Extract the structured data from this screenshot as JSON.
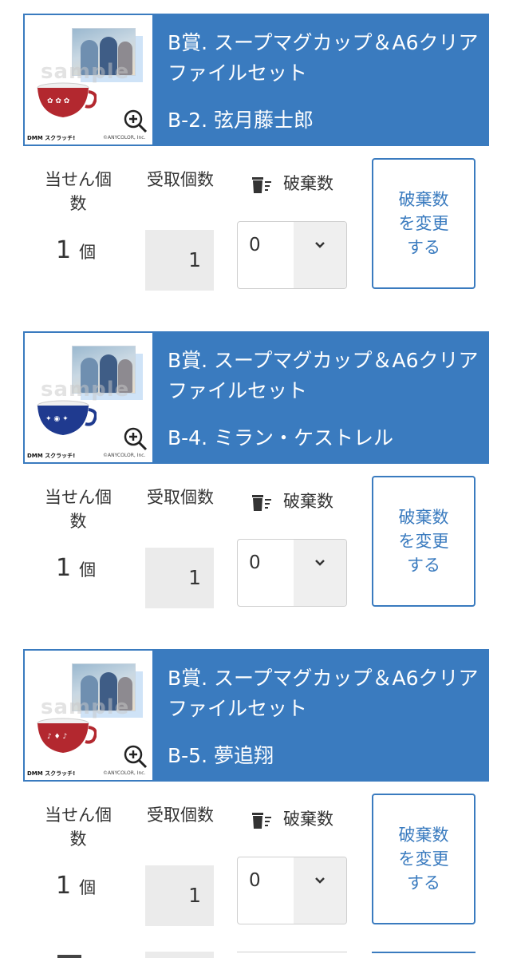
{
  "labels": {
    "won": "当せん個数",
    "received": "受取個数",
    "discard": "破棄数",
    "unit": "個",
    "change_button": "破棄数を変更する"
  },
  "thumbnail": {
    "watermark": "sample",
    "dmm_logo": "DMM スクラッチ!",
    "copyright": "©ANYCOLOR, Inc."
  },
  "items": [
    {
      "title": "B賞. スープマグカップ＆A6クリアファイルセット",
      "variant": "B-2. 弦月藤士郎",
      "won_count": "1",
      "received_count": "1",
      "discard_value": "0",
      "cup_color": "#b3282f",
      "cup_icon": "mug-red"
    },
    {
      "title": "B賞. スープマグカップ＆A6クリアファイルセット",
      "variant": "B-4. ミラン・ケストレル",
      "won_count": "1",
      "received_count": "1",
      "discard_value": "0",
      "cup_color": "#1f3a8f",
      "cup_icon": "mug-blue"
    },
    {
      "title": "B賞. スープマグカップ＆A6クリアファイルセット",
      "variant": "B-5. 夢追翔",
      "won_count": "1",
      "received_count": "1",
      "discard_value": "0",
      "cup_color": "#b3282f",
      "cup_icon": "mug-red"
    }
  ],
  "colors": {
    "accent": "#3a7bbf",
    "input_bg": "#ebebeb"
  }
}
